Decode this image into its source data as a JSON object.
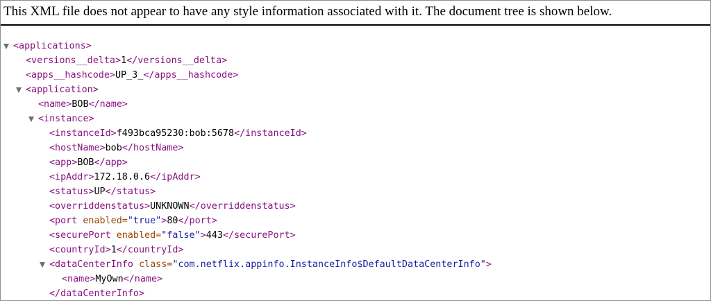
{
  "header": {
    "message": "This XML file does not appear to have any style information associated with it. The document tree is shown below."
  },
  "tree": {
    "applications_open": "<applications>",
    "versions_open": "<versions__delta>",
    "versions_value": "1",
    "versions_close": "</versions__delta>",
    "hashcode_open": "<apps__hashcode>",
    "hashcode_value": "UP_3_",
    "hashcode_close": "</apps__hashcode>",
    "application_open": "<application>",
    "name_open": "<name>",
    "name_value": "BOB",
    "name_close": "</name>",
    "instance_open": "<instance>",
    "instanceId_open": "<instanceId>",
    "instanceId_value": "f493bca95230:bob:5678",
    "instanceId_close": "</instanceId>",
    "hostName_open": "<hostName>",
    "hostName_value": "bob",
    "hostName_close": "</hostName>",
    "app_open": "<app>",
    "app_value": "BOB",
    "app_close": "</app>",
    "ipAddr_open": "<ipAddr>",
    "ipAddr_value": "172.18.0.6",
    "ipAddr_close": "</ipAddr>",
    "status_open": "<status>",
    "status_value": "UP",
    "status_close": "</status>",
    "overridden_open": "<overriddenstatus>",
    "overridden_value": "UNKNOWN",
    "overridden_close": "</overriddenstatus>",
    "port_tag": "<port",
    "port_attr": "enabled=",
    "port_attr_value": "\"true\"",
    "port_gt": ">",
    "port_value": "80",
    "port_close": "</port>",
    "secure_tag": "<securePort",
    "secure_attr": "enabled=",
    "secure_attr_value": "\"false\"",
    "secure_gt": ">",
    "secure_value": "443",
    "secure_close": "</securePort>",
    "country_open": "<countryId>",
    "country_value": "1",
    "country_close": "</countryId>",
    "dci_tag": "<dataCenterInfo",
    "dci_attr": "class=",
    "dci_attr_value": "\"com.netflix.appinfo.InstanceInfo$DefaultDataCenterInfo\"",
    "dci_gt": ">",
    "dci_name_open": "<name>",
    "dci_name_value": "MyOwn",
    "dci_name_close": "</name>",
    "dci_close": "</dataCenterInfo>"
  },
  "colors": {
    "tag": "#881280",
    "attribute_name": "#994500",
    "attribute_value": "#1a1aa6",
    "text": "#000000"
  },
  "icons": {
    "collapse_toggle": "triangle-down-icon"
  }
}
